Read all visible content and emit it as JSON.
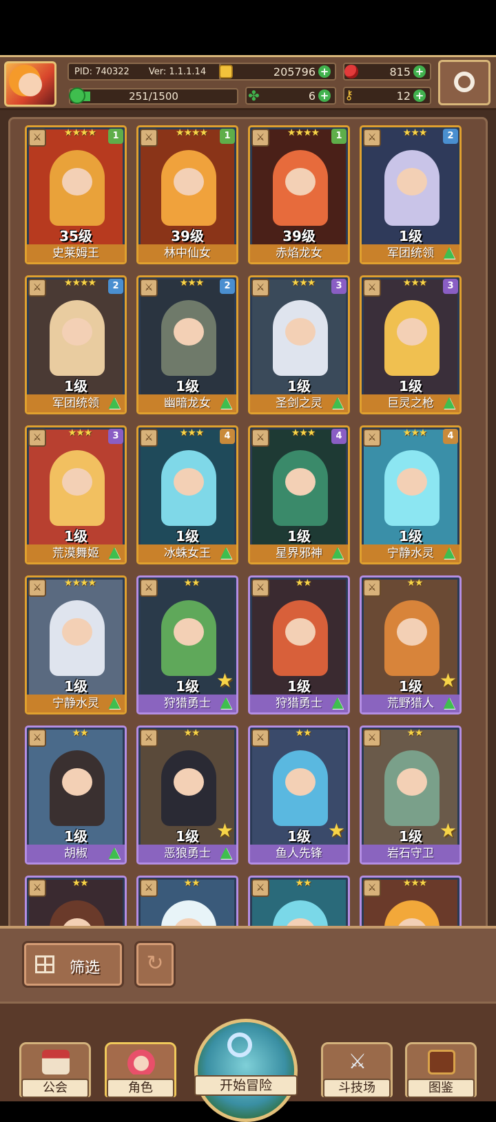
{
  "header": {
    "pid": "PID: 740322",
    "version": "Ver: 1.1.1.14",
    "energy": "251/1500",
    "energy_fraction": 0.05,
    "gold": "205796",
    "ruby": "815",
    "clover": "6",
    "key": "12"
  },
  "cards": [
    {
      "name": "史莱姆王",
      "level": "35级",
      "stars": "★★★★",
      "badge": "1",
      "badge_color": "#5fae4a",
      "border": "gold",
      "art": "#e9a23a",
      "bg": "#b73a1f",
      "big_star": false,
      "up": false
    },
    {
      "name": "林中仙女",
      "level": "39级",
      "stars": "★★★★",
      "badge": "1",
      "badge_color": "#5fae4a",
      "border": "gold",
      "art": "#f0a23c",
      "bg": "#8a3418",
      "big_star": false,
      "up": false
    },
    {
      "name": "赤焰龙女",
      "level": "39级",
      "stars": "★★★★",
      "badge": "1",
      "badge_color": "#5fae4a",
      "border": "gold",
      "art": "#e76b3c",
      "bg": "#4a2018",
      "big_star": false,
      "up": false
    },
    {
      "name": "军团统领",
      "level": "1级",
      "stars": "★★★",
      "badge": "2",
      "badge_color": "#4a8fd0",
      "border": "gold",
      "art": "#c9c4e8",
      "bg": "#2f3a5a",
      "big_star": false,
      "up": true
    },
    {
      "name": "军团统领",
      "level": "1级",
      "stars": "★★★★",
      "badge": "2",
      "badge_color": "#4a8fd0",
      "border": "gold",
      "art": "#e9cca0",
      "bg": "#4a3a34",
      "big_star": false,
      "up": true
    },
    {
      "name": "幽暗龙女",
      "level": "1级",
      "stars": "★★★",
      "badge": "2",
      "badge_color": "#4a8fd0",
      "border": "gold",
      "art": "#6f7a6a",
      "bg": "#2a3440",
      "big_star": false,
      "up": true
    },
    {
      "name": "圣剑之灵",
      "level": "1级",
      "stars": "★★★",
      "badge": "3",
      "badge_color": "#8a5ec4",
      "border": "gold",
      "art": "#dfe4ee",
      "bg": "#3a4a5a",
      "big_star": false,
      "up": true
    },
    {
      "name": "巨灵之枪",
      "level": "1级",
      "stars": "★★★",
      "badge": "3",
      "badge_color": "#8a5ec4",
      "border": "gold",
      "art": "#f0c050",
      "bg": "#3a2f3a",
      "big_star": false,
      "up": true
    },
    {
      "name": "荒漠舞姬",
      "level": "1级",
      "stars": "★★★",
      "badge": "3",
      "badge_color": "#8a5ec4",
      "border": "gold",
      "art": "#f2c060",
      "bg": "#b84030",
      "big_star": false,
      "up": true
    },
    {
      "name": "冰蛛女王",
      "level": "1级",
      "stars": "★★★",
      "badge": "4",
      "badge_color": "#c98a3a",
      "border": "gold",
      "art": "#7fd8e8",
      "bg": "#1f4a5a",
      "big_star": false,
      "up": true
    },
    {
      "name": "星界邪神",
      "level": "1级",
      "stars": "★★★",
      "badge": "4",
      "badge_color": "#8a5ec4",
      "border": "gold",
      "art": "#3a8a6a",
      "bg": "#1e3a34",
      "big_star": false,
      "up": true
    },
    {
      "name": "宁静水灵",
      "level": "1级",
      "stars": "★★★",
      "badge": "4",
      "badge_color": "#c98a3a",
      "border": "gold",
      "art": "#8ce6f2",
      "bg": "#3a8fa8",
      "big_star": false,
      "up": true
    },
    {
      "name": "宁静水灵",
      "level": "1级",
      "stars": "★★★★",
      "badge": "",
      "badge_color": "",
      "border": "gold",
      "art": "#dfe4ee",
      "bg": "#5a6a80",
      "big_star": false,
      "up": true
    },
    {
      "name": "狩猎勇士",
      "level": "1级",
      "stars": "★★",
      "badge": "",
      "badge_color": "",
      "border": "purple",
      "art": "#5fa85a",
      "bg": "#2a3a4a",
      "big_star": true,
      "up": true
    },
    {
      "name": "狩猎勇士",
      "level": "1级",
      "stars": "★★",
      "badge": "",
      "badge_color": "",
      "border": "purple",
      "art": "#d8603a",
      "bg": "#3a2a30",
      "big_star": false,
      "up": true
    },
    {
      "name": "荒野猎人",
      "level": "1级",
      "stars": "★★",
      "badge": "",
      "badge_color": "",
      "border": "purple",
      "art": "#d8843a",
      "bg": "#6a4a34",
      "big_star": true,
      "up": true
    },
    {
      "name": "胡椒",
      "level": "1级",
      "stars": "★★",
      "badge": "",
      "badge_color": "",
      "border": "purple",
      "art": "#3a3030",
      "bg": "#4a6a8a",
      "big_star": false,
      "up": true
    },
    {
      "name": "恶狼勇士",
      "level": "1级",
      "stars": "★★",
      "badge": "",
      "badge_color": "",
      "border": "purple",
      "art": "#2a2a34",
      "bg": "#5a4a3a",
      "big_star": true,
      "up": true
    },
    {
      "name": "鱼人先锋",
      "level": "1级",
      "stars": "★★",
      "badge": "",
      "badge_color": "",
      "border": "purple",
      "art": "#5ab8e0",
      "bg": "#3a4a6a",
      "big_star": true,
      "up": false
    },
    {
      "name": "岩石守卫",
      "level": "1级",
      "stars": "★★",
      "badge": "",
      "badge_color": "",
      "border": "purple",
      "art": "#7aa08a",
      "bg": "#6a5a4a",
      "big_star": true,
      "up": false
    },
    {
      "name": "",
      "level": "",
      "stars": "★★",
      "badge": "",
      "badge_color": "",
      "border": "purple",
      "art": "#6a3a2a",
      "bg": "#3a2a30",
      "big_star": false,
      "up": false
    },
    {
      "name": "",
      "level": "",
      "stars": "★★",
      "badge": "",
      "badge_color": "",
      "border": "purple",
      "art": "#e8f4f8",
      "bg": "#3a5a7a",
      "big_star": false,
      "up": false
    },
    {
      "name": "",
      "level": "",
      "stars": "★★",
      "badge": "",
      "badge_color": "",
      "border": "purple",
      "art": "#7ad8e8",
      "bg": "#2a6a7a",
      "big_star": false,
      "up": false
    },
    {
      "name": "",
      "level": "",
      "stars": "★★★",
      "badge": "",
      "badge_color": "",
      "border": "purple",
      "art": "#f2a83a",
      "bg": "#6a3a2a",
      "big_star": false,
      "up": false
    }
  ],
  "filter": {
    "label": "筛选"
  },
  "nav": {
    "guild": "公会",
    "character": "角色",
    "adventure": "开始冒险",
    "arena": "斗技场",
    "codex": "图鉴"
  }
}
